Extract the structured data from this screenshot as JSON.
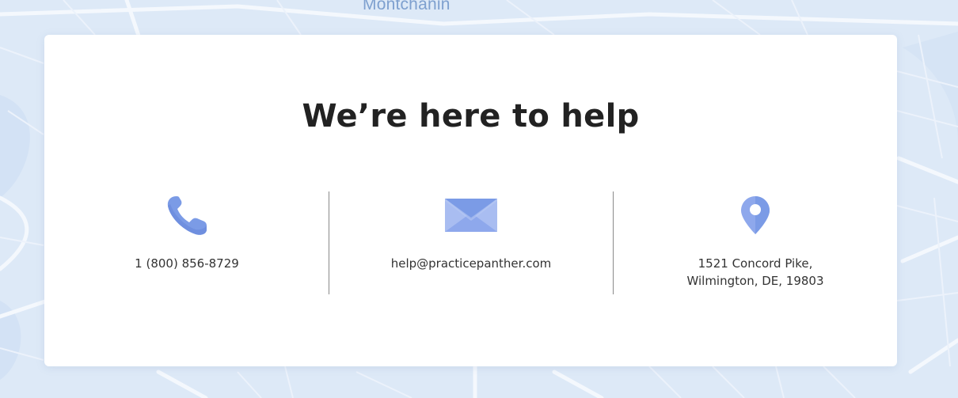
{
  "map": {
    "place_label": "Montchanin"
  },
  "contact_card": {
    "heading": "We’re here to help",
    "phone": {
      "icon": "phone-icon",
      "text": "1 (800) 856-8729"
    },
    "email": {
      "icon": "envelope-icon",
      "text": "help@practicepanther.com"
    },
    "address": {
      "icon": "location-pin-icon",
      "line1": "1521 Concord Pike,",
      "line2": "Wilmington, DE, 19803"
    }
  },
  "colors": {
    "icon_primary": "#7b9be6",
    "icon_light": "#a9bdf1",
    "map_background": "#dde9f7",
    "map_label": "#7ea0cf",
    "heading_text": "#222222",
    "body_text": "#333333"
  }
}
